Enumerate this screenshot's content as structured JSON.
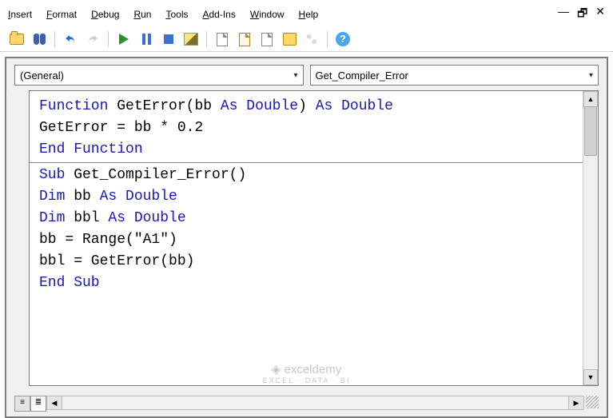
{
  "menu": {
    "insert": "nsert",
    "insert_u": "I",
    "format": "ormat",
    "format_u": "F",
    "debug": "ebug",
    "debug_u": "D",
    "run": "un",
    "run_u": "R",
    "tools": "ools",
    "tools_u": "T",
    "addins": "dd-Ins",
    "addins_u": "A",
    "window": "indow",
    "window_u": "W",
    "help": "elp",
    "help_u": "H"
  },
  "dropdowns": {
    "object": "(General)",
    "procedure": "Get_Compiler_Error"
  },
  "code": {
    "l1a": "Function",
    "l1b": " GetError(bb ",
    "l1c": "As Double",
    "l1d": ") ",
    "l1e": "As Double",
    "l2": "  GetError = bb * 0.2",
    "l3": "End Function",
    "l4a": "Sub",
    "l4b": " Get_Compiler_Error()",
    "l5a": "  Dim",
    "l5b": " bb ",
    "l5c": "As Double",
    "l6a": "  Dim",
    "l6b": " bbl ",
    "l6c": "As Double",
    "l7": "  bb = Range(\"A1\")",
    "l8": "  bbl = GetError(bb)",
    "l9": "End Sub"
  },
  "help_glyph": "?",
  "watermark": {
    "main": "exceldemy",
    "sub": "EXCEL · DATA · BI"
  }
}
